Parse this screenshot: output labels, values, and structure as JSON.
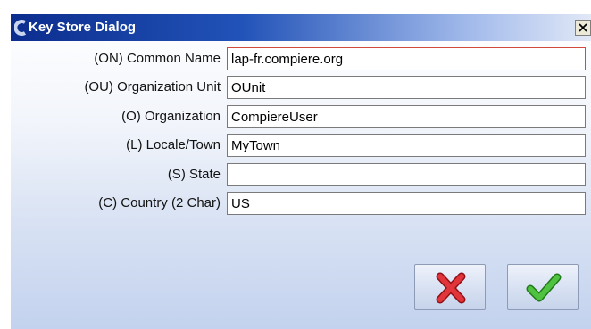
{
  "dialog": {
    "title": "Key Store Dialog",
    "close_glyph": "×"
  },
  "fields": [
    {
      "label": "(ON) Common Name",
      "value": "lap-fr.compiere.org"
    },
    {
      "label": "(OU) Organization Unit",
      "value": "OUnit"
    },
    {
      "label": "(O) Organization",
      "value": "CompiereUser"
    },
    {
      "label": "(L) Locale/Town",
      "value": "MyTown"
    },
    {
      "label": "(S) State",
      "value": ""
    },
    {
      "label": "(C) Country (2 Char)",
      "value": "US"
    }
  ],
  "buttons": {
    "cancel_icon": "red-x-icon",
    "ok_icon": "green-check-icon"
  },
  "colors": {
    "title_bar": "#0b2d8e",
    "focused_border": "#d24a3b",
    "cancel_red": "#d8232a",
    "ok_green": "#3cae2f"
  }
}
